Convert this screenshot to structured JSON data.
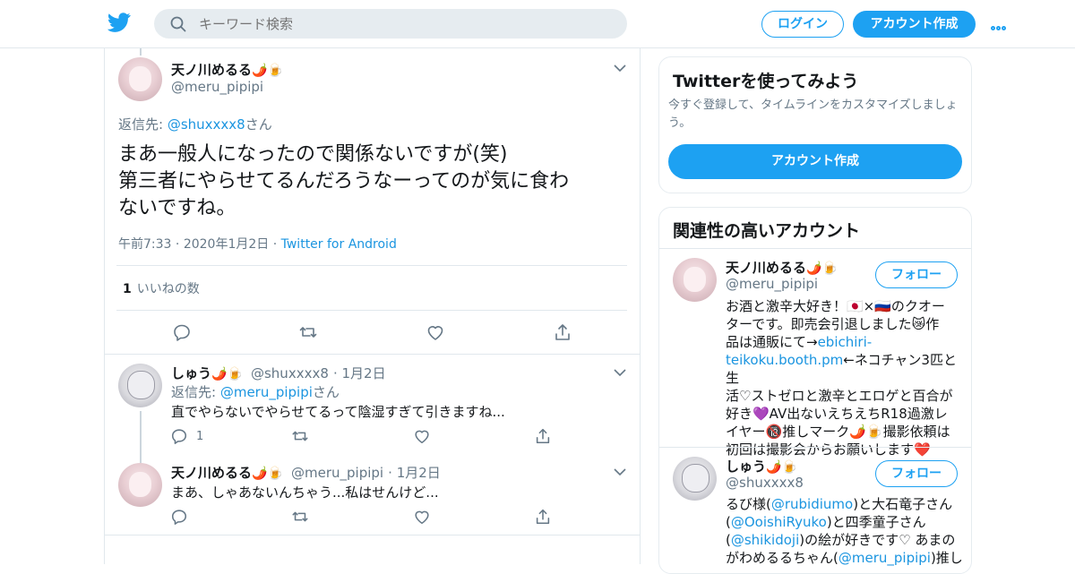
{
  "header": {
    "search_placeholder": "キーワード検索",
    "login_label": "ログイン",
    "signup_label": "アカウント作成"
  },
  "focus_tweet": {
    "name": "天ノ川めるる",
    "name_emoji": "🌶️🍺",
    "handle": "@meru_pipipi",
    "reply_prefix": "返信先: ",
    "reply_to": "@shuxxxx8",
    "reply_suffix": "さん",
    "text_line1": "まあ一般人になったので関係ないですが(笑)",
    "text_line2": "第三者にやらせてるんだろうなーってのが気に食わ",
    "text_line3": "ないですね。",
    "time": "午前7:33",
    "date": "2020年1月2日",
    "source": "Twitter for Android",
    "like_count": "1",
    "like_label": "いいねの数"
  },
  "replies": [
    {
      "name": "しゅう",
      "name_emoji": "🌶️🍺",
      "handle": "@shuxxxx8",
      "date": "1月2日",
      "reply_prefix": "返信先: ",
      "reply_to": "@meru_pipipi",
      "reply_suffix": "さん",
      "text": "直でやらないでやらせてるって陰湿すぎて引きますね...",
      "reply_count": "1"
    },
    {
      "name": "天ノ川めるる",
      "name_emoji": "🌶️🍺",
      "handle": "@meru_pipipi",
      "date": "1月2日",
      "text": "まあ、しゃあないんちゃう...私はせんけど..."
    }
  ],
  "sidebar": {
    "try_card": {
      "title": "Twitterを使ってみよう",
      "subtitle_line1": "今すぐ登録して、タイムラインをカスタマイズしましょ",
      "subtitle_line2": "う。",
      "button_label": "アカウント作成"
    },
    "related": {
      "title": "関連性の高いアカウント",
      "follow_label": "フォロー",
      "accounts": [
        {
          "name": "天ノ川めるる",
          "name_emoji": "🌶️🍺",
          "handle": "@meru_pipipi",
          "bio_line1": "お酒と激辛大好き！🇯🇵×🇷🇺のクオー",
          "bio_line2": "ターです。即売会引退しました😿作",
          "bio_line3": "品は通販にて→",
          "bio_link1": "ebichiri-",
          "bio_link2": "teikoku.booth.pm",
          "bio_line4": "←ネコチャン3匹と生",
          "bio_line5": "活♡ストゼロと激辛とエロゲと百合が",
          "bio_line6": "好き💜AV出ないえちえちR18過激レ",
          "bio_line7": "イヤー🔞推しマーク🌶️🍺撮影依頼は",
          "bio_line8": "初回は撮影会からお願いします❤️"
        },
        {
          "name": "しゅう",
          "name_emoji": "🌶️🍺",
          "handle": "@shuxxxx8",
          "bio_a1": "るび様(",
          "bio_link_a": "@rubidiumo",
          "bio_a2": ")と大石竜子さん",
          "bio_b1": "(",
          "bio_link_b": "@OoishiRyuko",
          "bio_b2": ")と四季童子さん",
          "bio_c1": "(",
          "bio_link_c": "@shikidoji",
          "bio_c2": ")の絵が好きです♡ あまの",
          "bio_d1": "がわめるるちゃん(",
          "bio_link_d": "@meru_pipipi",
          "bio_d2": ")推し"
        }
      ]
    }
  },
  "colors": {
    "accent": "#1da1f2",
    "link": "#1b95e0",
    "muted": "#657786",
    "border": "#e1e8ed"
  },
  "icons": [
    "twitter-bird-icon",
    "search-icon",
    "more-icon",
    "chevron-down-icon",
    "reply-icon",
    "retweet-icon",
    "like-icon",
    "share-icon"
  ]
}
